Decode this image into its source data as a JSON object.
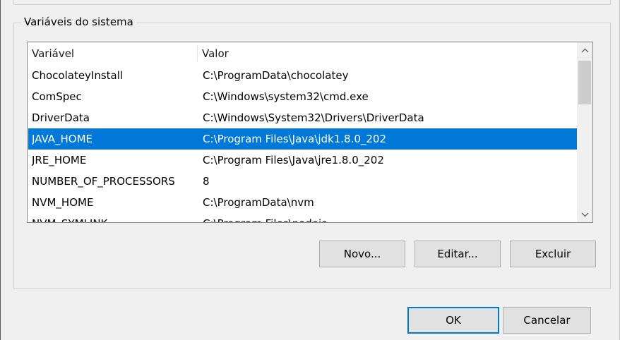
{
  "group_title": "Variáveis do sistema",
  "columns": {
    "name": "Variável",
    "value": "Valor"
  },
  "rows": [
    {
      "name": "ChocolateyInstall",
      "value": "C:\\ProgramData\\chocolatey",
      "selected": false
    },
    {
      "name": "ComSpec",
      "value": "C:\\Windows\\system32\\cmd.exe",
      "selected": false
    },
    {
      "name": "DriverData",
      "value": "C:\\Windows\\System32\\Drivers\\DriverData",
      "selected": false
    },
    {
      "name": "JAVA_HOME",
      "value": "C:\\Program Files\\Java\\jdk1.8.0_202",
      "selected": true
    },
    {
      "name": "JRE_HOME",
      "value": "C:\\Program Files\\Java\\jre1.8.0_202",
      "selected": false
    },
    {
      "name": "NUMBER_OF_PROCESSORS",
      "value": "8",
      "selected": false
    },
    {
      "name": "NVM_HOME",
      "value": "C:\\ProgramData\\nvm",
      "selected": false
    },
    {
      "name": "NVM_SYMLINK",
      "value": "C:\\Program Files\\nodejs",
      "selected": false
    }
  ],
  "list_buttons": {
    "new": "Novo...",
    "edit": "Editar...",
    "delete": "Excluir"
  },
  "dialog_buttons": {
    "ok": "OK",
    "cancel": "Cancelar"
  },
  "colors": {
    "selection": "#0078d7",
    "default_button_border": "#0078d7"
  },
  "icons": {
    "scroll_up": "chevron-up-icon",
    "scroll_down": "chevron-down-icon"
  }
}
